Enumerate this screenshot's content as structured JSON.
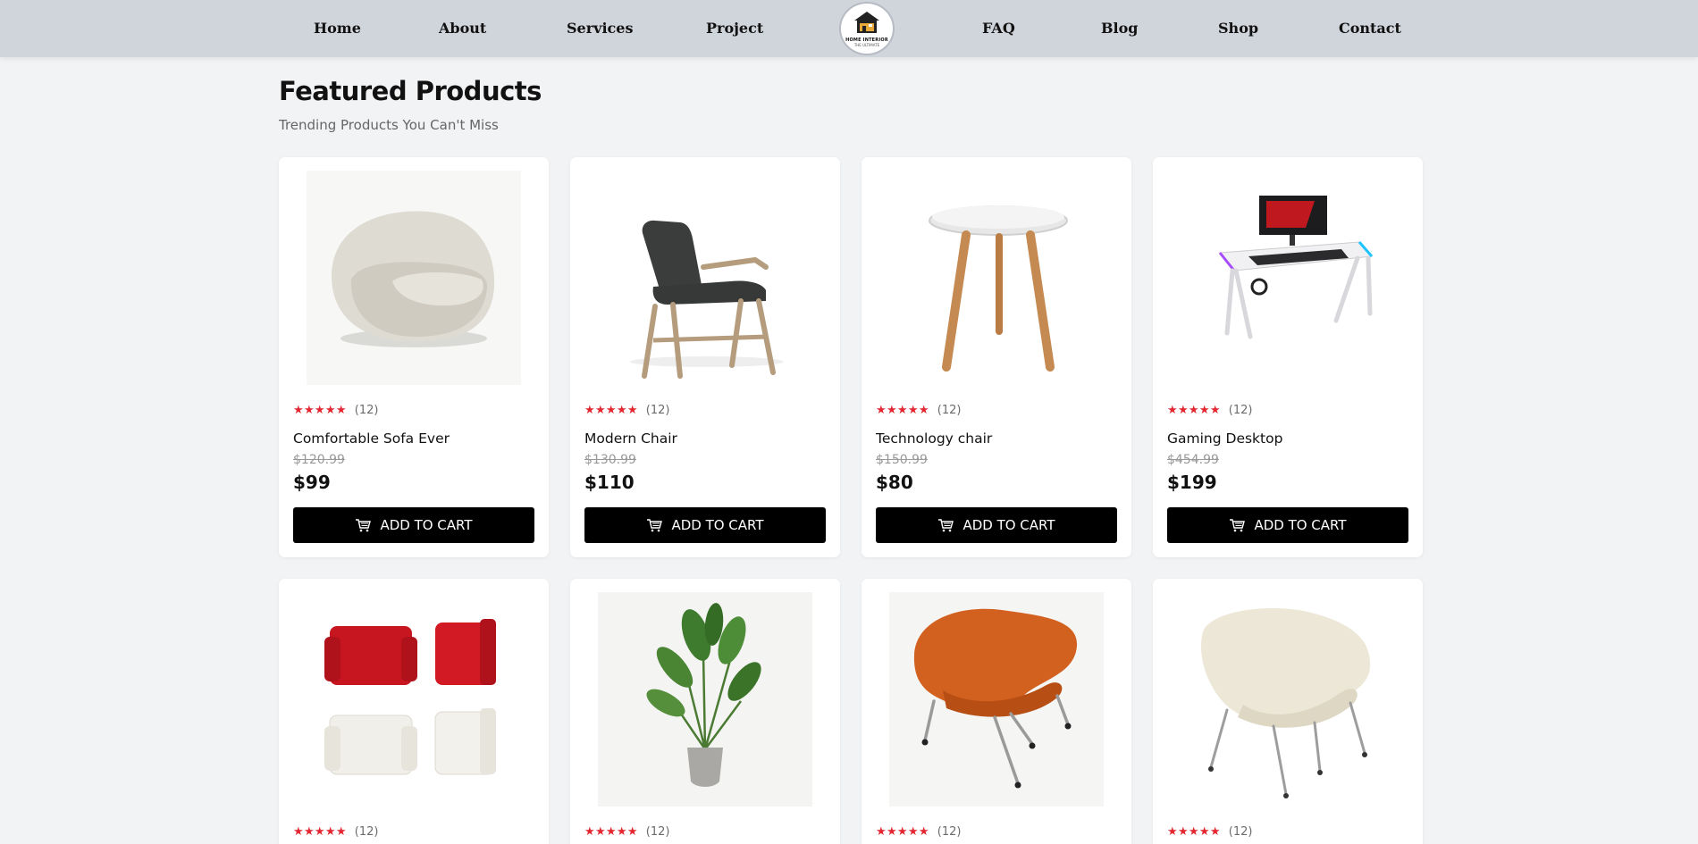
{
  "nav": {
    "items": [
      {
        "label": "Home"
      },
      {
        "label": "About"
      },
      {
        "label": "Services"
      },
      {
        "label": "Project"
      },
      {
        "label": "FAQ"
      },
      {
        "label": "Blog"
      },
      {
        "label": "Shop"
      },
      {
        "label": "Contact"
      }
    ],
    "logo": {
      "text": "HOME INTERIOR",
      "sub": "THE ULTIMATE"
    }
  },
  "header": {
    "title": "Featured Products",
    "subtitle": "Trending Products You Can't Miss"
  },
  "products": [
    {
      "stars": "★★★★★",
      "reviews": "(12)",
      "name": "Comfortable Sofa Ever",
      "old_price": "$120.99",
      "price": "$99",
      "button": "ADD TO CART"
    },
    {
      "stars": "★★★★★",
      "reviews": "(12)",
      "name": "Modern Chair",
      "old_price": "$130.99",
      "price": "$110",
      "button": "ADD TO CART"
    },
    {
      "stars": "★★★★★",
      "reviews": "(12)",
      "name": "Technology chair",
      "old_price": "$150.99",
      "price": "$80",
      "button": "ADD TO CART"
    },
    {
      "stars": "★★★★★",
      "reviews": "(12)",
      "name": "Gaming Desktop",
      "old_price": "$454.99",
      "price": "$199",
      "button": "ADD TO CART"
    },
    {
      "stars": "★★★★★",
      "reviews": "(12)"
    },
    {
      "stars": "★★★★★",
      "reviews": "(12)"
    },
    {
      "stars": "★★★★★",
      "reviews": "(12)"
    },
    {
      "stars": "★★★★★",
      "reviews": "(12)"
    }
  ],
  "colors": {
    "star": "#e3262f",
    "nav_bg": "#d0d4db",
    "button_bg": "#000000",
    "page_bg": "#f2f3f5"
  }
}
